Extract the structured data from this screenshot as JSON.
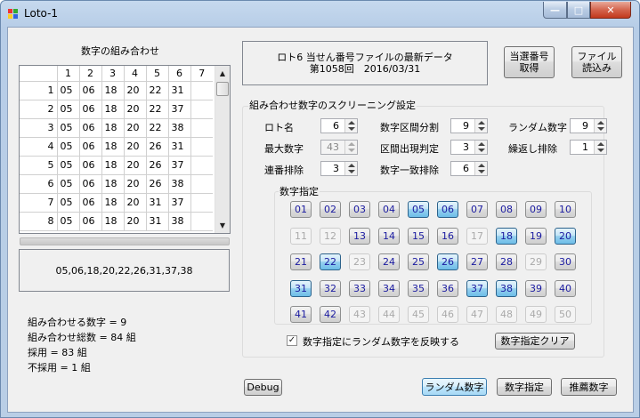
{
  "window": {
    "title": "Loto-1"
  },
  "titlebar_buttons": {
    "minimize": "—",
    "maximize": "□",
    "close": "✕"
  },
  "header": {
    "combo_title": "数字の組み合わせ"
  },
  "grid": {
    "columns": [
      "",
      "1",
      "2",
      "3",
      "4",
      "5",
      "6",
      "7"
    ],
    "rows": [
      [
        "1",
        "05",
        "06",
        "18",
        "20",
        "22",
        "31",
        ""
      ],
      [
        "2",
        "05",
        "06",
        "18",
        "20",
        "22",
        "37",
        ""
      ],
      [
        "3",
        "05",
        "06",
        "18",
        "20",
        "22",
        "38",
        ""
      ],
      [
        "4",
        "05",
        "06",
        "18",
        "20",
        "26",
        "31",
        ""
      ],
      [
        "5",
        "05",
        "06",
        "18",
        "20",
        "26",
        "37",
        ""
      ],
      [
        "6",
        "05",
        "06",
        "18",
        "20",
        "26",
        "38",
        ""
      ],
      [
        "7",
        "05",
        "06",
        "18",
        "20",
        "31",
        "37",
        ""
      ],
      [
        "8",
        "05",
        "06",
        "18",
        "20",
        "31",
        "38",
        ""
      ]
    ]
  },
  "selected_combo": "05,06,18,20,22,26,31,37,38",
  "stats": {
    "line1": "組み合わせる数字 = 9",
    "line2": "組み合わせ総数 = 84 組",
    "line3": "採用 = 83 組",
    "line4": "不採用 = 1 組"
  },
  "file_info": {
    "line1": "ロト6 当せん番号ファイルの最新データ",
    "line2": "第1058回　2016/03/31"
  },
  "buttons": {
    "get_numbers": "当選番号\n取得",
    "load_file": "ファイル\n読込み",
    "debug": "Debug",
    "random": "ランダム数字",
    "specify": "数字指定",
    "recommend": "推薦数字",
    "clear_specify": "数字指定クリア"
  },
  "screening": {
    "title": "組み合わせ数字のスクリーニング設定",
    "loto_name": {
      "label": "ロト名",
      "value": "6"
    },
    "max_number": {
      "label": "最大数字",
      "value": "43"
    },
    "consecutive": {
      "label": "連番排除",
      "value": "3"
    },
    "split": {
      "label": "数字区間分割",
      "value": "9"
    },
    "interval": {
      "label": "区間出現判定",
      "value": "3"
    },
    "match_exclude": {
      "label": "数字一致排除",
      "value": "6"
    },
    "random_count": {
      "label": "ランダム数字",
      "value": "9"
    },
    "repeat_exclude": {
      "label": "繰返し排除",
      "value": "1"
    }
  },
  "number_select": {
    "title": "数字指定",
    "selected": [
      "05",
      "06",
      "18",
      "20",
      "22",
      "26",
      "31",
      "37",
      "38"
    ],
    "disabled_from": 43
  },
  "checkbox": {
    "label": "数字指定にランダム数字を反映する",
    "checked": true,
    "mark": "✓"
  }
}
